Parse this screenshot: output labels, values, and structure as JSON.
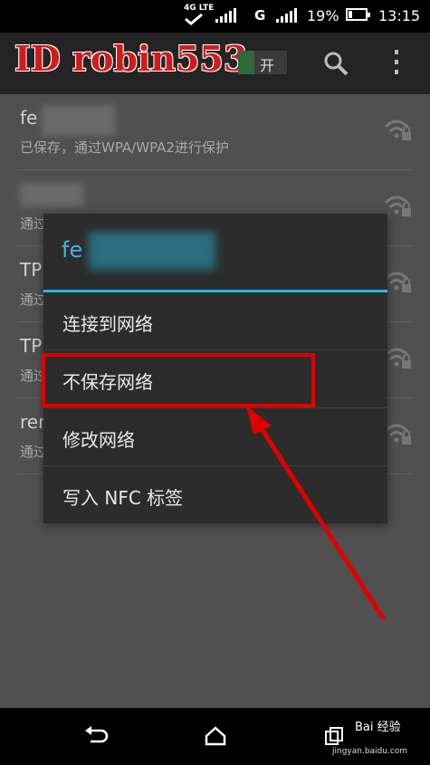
{
  "status_bar": {
    "network_type": "4G LTE",
    "carrier_g": "G",
    "battery_percent": "19%",
    "time": "13:15",
    "battery_level": 0.19
  },
  "action_bar": {
    "watermark": "ID robin553",
    "toggle_label": "开",
    "icons": [
      "search-icon",
      "more-vert-icon"
    ]
  },
  "wifi_list": [
    {
      "name": "fe",
      "status": "已保存，通过WPA/WPA2进行保护"
    },
    {
      "name": "",
      "status": "通过"
    },
    {
      "name": "TP",
      "status": "通过"
    },
    {
      "name": "TP",
      "status": "通过"
    },
    {
      "name": "ren",
      "status": "通过"
    }
  ],
  "dialog": {
    "title": "fe",
    "items": [
      {
        "label": "连接到网络"
      },
      {
        "label": "不保存网络"
      },
      {
        "label": "修改网络"
      },
      {
        "label": "写入 NFC 标签"
      }
    ],
    "accent_color": "#33b5e5"
  },
  "annotation": {
    "highlight_color": "#e00000",
    "highlighted_item": "不保存网络"
  },
  "nav_bar": {
    "icons": [
      "back-icon",
      "home-icon",
      "recents-icon"
    ],
    "source_logo": "Bai 经验",
    "source_url": "jingyan.baidu.com"
  }
}
